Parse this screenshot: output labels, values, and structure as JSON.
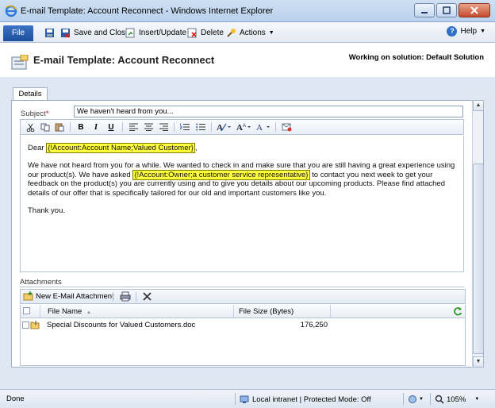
{
  "window": {
    "title": "E-mail Template: Account Reconnect - Windows Internet Explorer"
  },
  "ribbon": {
    "file_label": "File",
    "save_close_label": "Save and Close",
    "insert_update_label": "Insert/Update",
    "delete_label": "Delete",
    "actions_label": "Actions",
    "help_label": "Help"
  },
  "header": {
    "title": "E-mail Template: Account Reconnect",
    "solution": "Working on solution: Default Solution"
  },
  "tabs": {
    "details": "Details"
  },
  "form": {
    "subject_label": "Subject",
    "required_mark": "*",
    "subject_value": "We haven't heard from you..."
  },
  "body": {
    "dear": "Dear",
    "slug_account_name": "{!Account:Account Name;Valued Customer}",
    "dear_end": ",",
    "para1_a": "We have not heard from you for a while. We wanted to check in and make sure that you are still having a great experience using our product(s). We have asked",
    "slug_owner": "{!Account:Owner;a customer service representative}",
    "para1_b": "to contact you next week to get your feedback on the product(s) you are currently using and to give you details about our upcoming products. Please find attached details of our offer that is specifically tailored for our old and important customers like you.",
    "thanks": "Thank you."
  },
  "attachments": {
    "label": "Attachments",
    "new_label": "New E-Mail Attachment",
    "columns": {
      "file_name": "File Name",
      "file_size": "File Size (Bytes)"
    },
    "rows": [
      {
        "file_name": "Special Discounts for Valued Customers.doc",
        "file_size": "176,250"
      }
    ]
  },
  "status": {
    "done": "Done",
    "zone": "Local intranet | Protected Mode: Off",
    "zoom": "105%"
  }
}
